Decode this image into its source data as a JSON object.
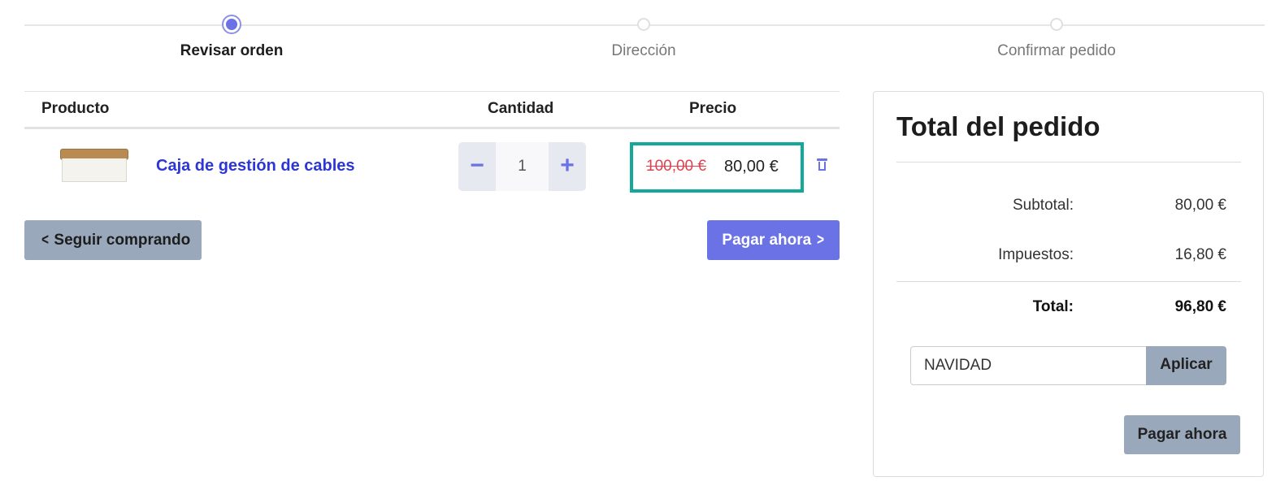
{
  "steps": [
    {
      "label": "Revisar orden",
      "active": true
    },
    {
      "label": "Dirección",
      "active": false
    },
    {
      "label": "Confirmar pedido",
      "active": false
    }
  ],
  "cart": {
    "headers": {
      "product": "Producto",
      "quantity": "Cantidad",
      "price": "Precio"
    },
    "items": [
      {
        "name": "Caja de gestión de cables",
        "quantity": "1",
        "old_price": "100,00 €",
        "price": "80,00 €",
        "image": "cable-box-image"
      }
    ]
  },
  "actions": {
    "continue_label": "Seguir comprando",
    "pay_label": "Pagar ahora"
  },
  "summary": {
    "title": "Total del pedido",
    "subtotal_label": "Subtotal:",
    "subtotal_value": "80,00 €",
    "taxes_label": "Impuestos:",
    "taxes_value": "16,80 €",
    "total_label": "Total:",
    "total_value": "96,80 €",
    "coupon_value": "NAVIDAD",
    "apply_label": "Aplicar",
    "pay_label": "Pagar ahora"
  },
  "colors": {
    "accent": "#6b72e6",
    "link": "#2c36d6",
    "highlight_border": "#14a89b",
    "discount_red": "#e0404f",
    "secondary_button": "#9aa8bb"
  }
}
